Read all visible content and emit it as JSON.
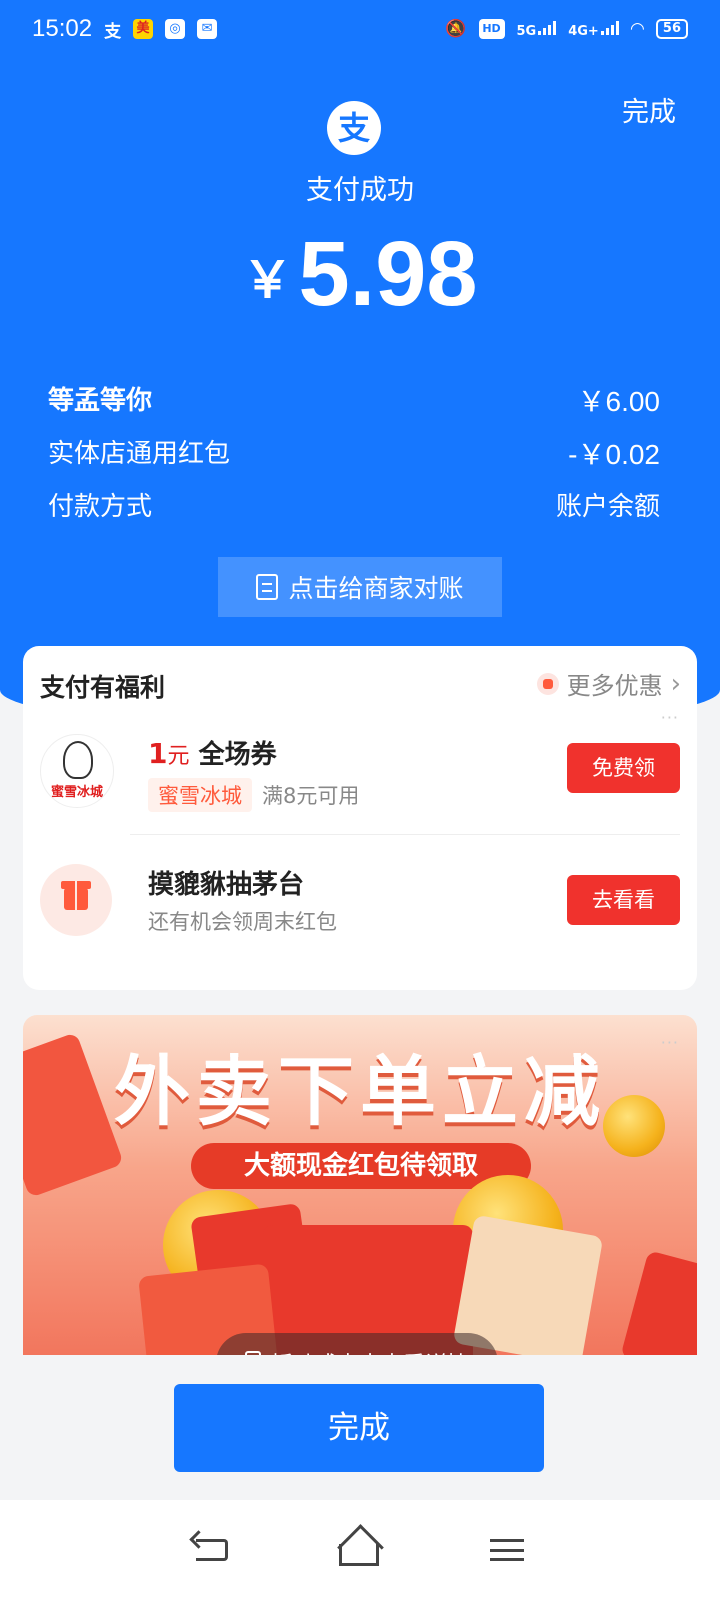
{
  "status_bar": {
    "time": "15:02",
    "app_badges": [
      "支",
      "美团",
      "",
      ""
    ],
    "hd": "HD",
    "network_1": "5G",
    "network_2": "4G+",
    "battery": "56"
  },
  "header": {
    "done_label": "完成",
    "logo_char": "支",
    "status_text": "支付成功",
    "currency": "￥",
    "amount": "5.98"
  },
  "details": [
    {
      "label": "等孟等你",
      "value": "￥6.00"
    },
    {
      "label": "实体店通用红包",
      "value": "-￥0.02"
    },
    {
      "label": "付款方式",
      "value": "账户余额"
    }
  ],
  "reconcile_button": "点击给商家对账",
  "benefits": {
    "title": "支付有福利",
    "more_label": "更多优惠",
    "dots": "···",
    "offers": [
      {
        "amount": "1",
        "unit": "元",
        "title": "全场券",
        "merchant": "蜜雪冰城",
        "logo_text": "蜜雪冰城",
        "condition": "满8元可用",
        "button": "免费领"
      },
      {
        "title": "摸貔貅抽茅台",
        "subtitle": "还有机会领周末红包",
        "button": "去看看"
      }
    ]
  },
  "banner": {
    "title": "外卖下单立减",
    "subtitle": "大额现金红包待领取",
    "hint": "摇动或点击查看详情",
    "dots": "···"
  },
  "done_button": "完成",
  "colors": {
    "brand_blue": "#1677ff",
    "red_button": "#f0322d",
    "accent_red": "#e02020"
  }
}
